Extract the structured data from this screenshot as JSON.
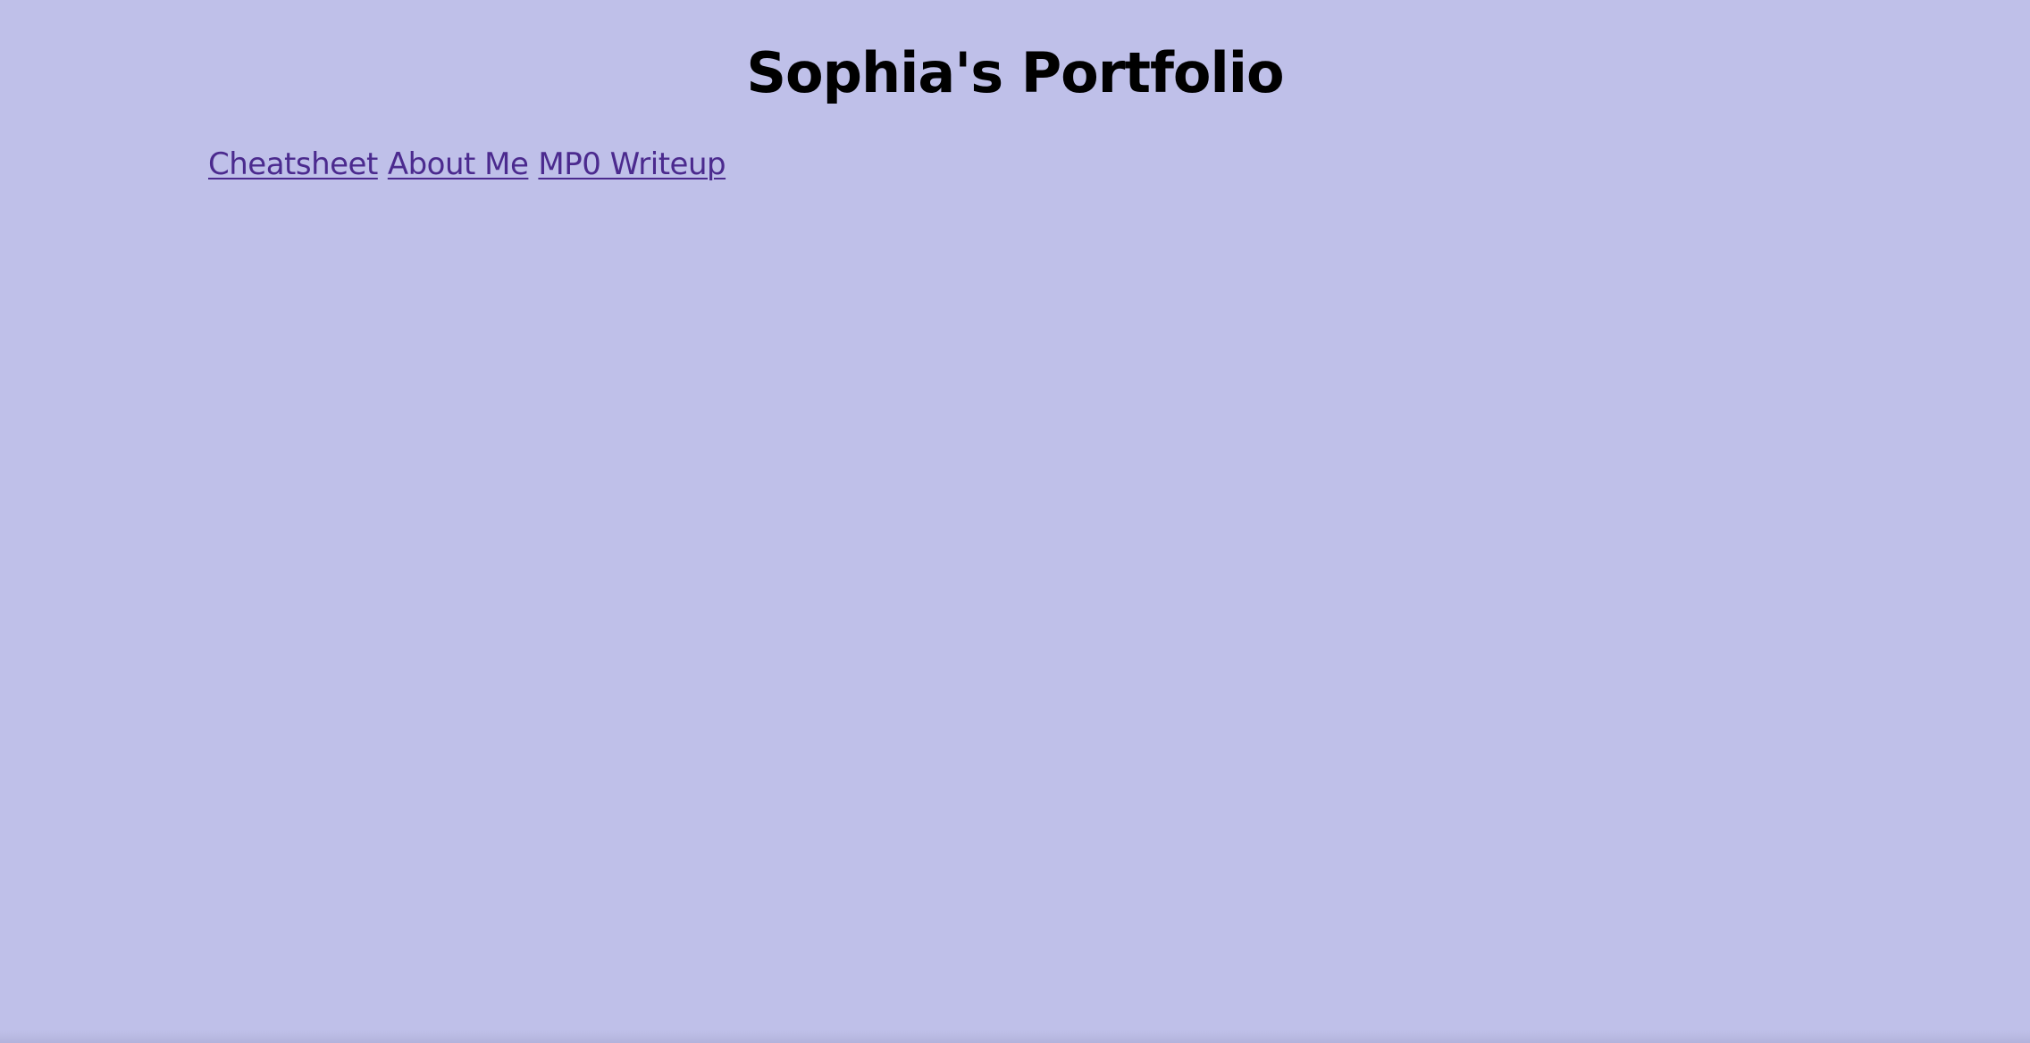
{
  "header": {
    "title": "Sophia's Portfolio"
  },
  "nav": {
    "links": [
      {
        "label": "Cheatsheet"
      },
      {
        "label": "About Me"
      },
      {
        "label": "MP0 Writeup"
      }
    ]
  },
  "colors": {
    "background": "#bfc0e9",
    "link": "#4b2a8e",
    "title": "#000000"
  }
}
